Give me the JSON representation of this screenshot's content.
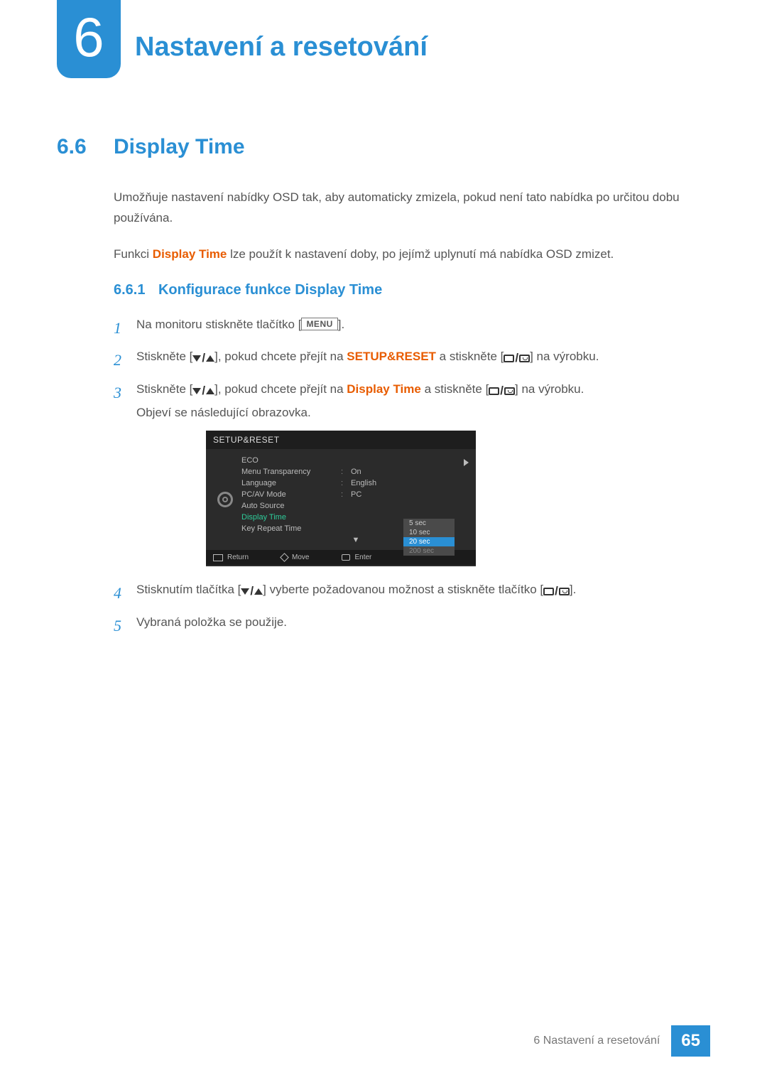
{
  "chapter": {
    "number": "6",
    "title": "Nastavení a resetování"
  },
  "section": {
    "number": "6.6",
    "title": "Display Time"
  },
  "intro": {
    "p1": "Umožňuje nastavení nabídky OSD tak, aby automaticky zmizela, pokud není tato nabídka po určitou dobu používána.",
    "p2_pre": "Funkci ",
    "p2_hl": "Display Time",
    "p2_post": " lze použít k nastavení doby, po jejímž uplynutí má nabídka OSD zmizet."
  },
  "subsection": {
    "number": "6.6.1",
    "title": "Konfigurace funkce Display Time"
  },
  "steps": {
    "s1_pre": "Na monitoru stiskněte tlačítko [",
    "s1_key": "MENU",
    "s1_post": "].",
    "s2_pre": "Stiskněte [",
    "s2_mid": "], pokud chcete přejít na ",
    "s2_hl": "SETUP&RESET",
    "s2_mid2": " a stiskněte [",
    "s2_post": "] na výrobku.",
    "s3_pre": "Stiskněte [",
    "s3_mid": "], pokud chcete přejít na ",
    "s3_hl": "Display Time",
    "s3_mid2": " a stiskněte [",
    "s3_post": "] na výrobku.",
    "s3_line2": "Objeví se následující obrazovka.",
    "s4_pre": "Stisknutím tlačítka [",
    "s4_mid": "] vyberte požadovanou možnost a stiskněte tlačítko [",
    "s4_post": "].",
    "s5": "Vybraná položka se použije."
  },
  "step_numbers": {
    "n1": "1",
    "n2": "2",
    "n3": "3",
    "n4": "4",
    "n5": "5"
  },
  "osd": {
    "title": "SETUP&RESET",
    "items": {
      "eco": "ECO",
      "menu_transparency": "Menu Transparency",
      "language": "Language",
      "pcav": "PC/AV Mode",
      "auto_source": "Auto Source",
      "display_time": "Display Time",
      "key_repeat": "Key Repeat Time"
    },
    "values": {
      "menu_transparency": "On",
      "language": "English",
      "pcav": "PC"
    },
    "popup": {
      "o1": "5 sec",
      "o2": "10 sec",
      "o3": "20 sec",
      "o4": "200 sec"
    },
    "footer": {
      "return": "Return",
      "move": "Move",
      "enter": "Enter"
    }
  },
  "footer": {
    "text": "6 Nastavení a resetování",
    "page": "65"
  }
}
